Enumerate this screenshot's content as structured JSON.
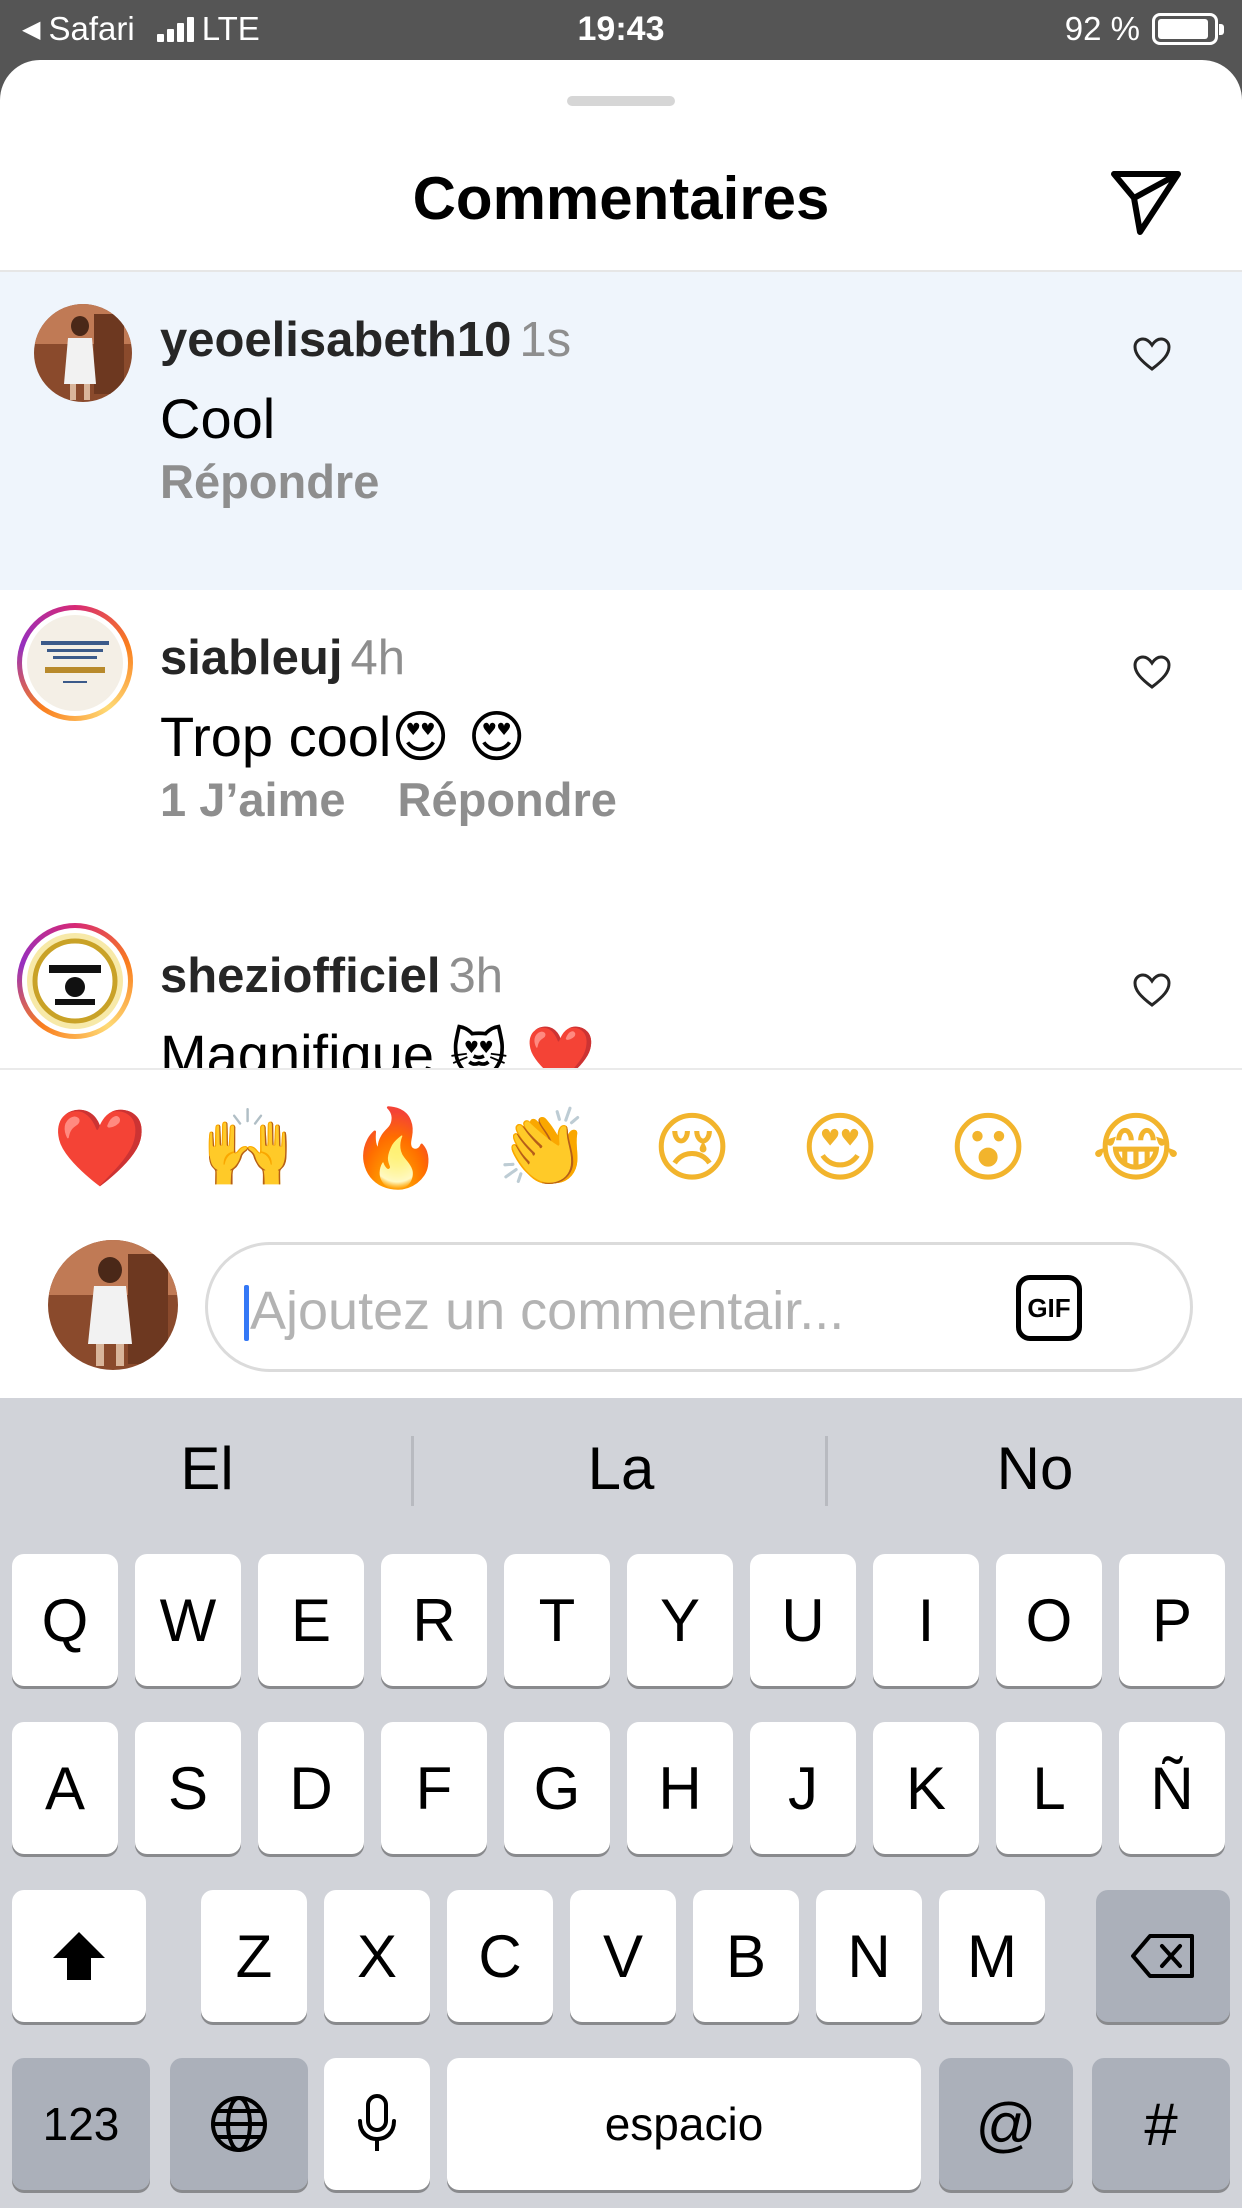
{
  "status_bar": {
    "back_glyph": "◀",
    "back_app": "Safari",
    "network": "LTE",
    "time": "19:43",
    "battery": "92 %",
    "battery_level": 0.92
  },
  "header": {
    "title": "Commentaires",
    "send_icon": "paper-plane-icon"
  },
  "comments": [
    {
      "username": "yeoelisabeth10",
      "time": "1s",
      "text": "Cool",
      "emojis": "",
      "actions": [
        "Répondre"
      ],
      "highlighted": true
    },
    {
      "username": "siableuj",
      "time": "4h",
      "text": "Trop cool",
      "emojis": "😍 😍",
      "actions": [
        "1 J’aime",
        "Répondre"
      ],
      "highlighted": false
    },
    {
      "username": "sheziofficiel",
      "time": "3h",
      "text": "Magnifique ",
      "emojis": "😻 ❤️",
      "actions": [],
      "highlighted": false
    }
  ],
  "reactions": [
    "❤️",
    "🙌",
    "🔥",
    "👏",
    "😢",
    "😍",
    "😮",
    "😂"
  ],
  "composer": {
    "placeholder": "Ajoutez un commentair...",
    "gif_label": "GIF"
  },
  "keyboard": {
    "suggestions": [
      "El",
      "La",
      "No"
    ],
    "row1": [
      "Q",
      "W",
      "E",
      "R",
      "T",
      "Y",
      "U",
      "I",
      "O",
      "P"
    ],
    "row2": [
      "A",
      "S",
      "D",
      "F",
      "G",
      "H",
      "J",
      "K",
      "L",
      "Ñ"
    ],
    "row3": [
      "Z",
      "X",
      "C",
      "V",
      "B",
      "N",
      "M"
    ],
    "numbers_label": "123",
    "space_label": "espacio",
    "at_label": "@",
    "hash_label": "#",
    "icons": {
      "shift": "shift-icon",
      "delete": "backspace-icon",
      "globe": "globe-icon",
      "mic": "microphone-icon"
    }
  },
  "colors": {
    "accent": "#3478f6",
    "highlight": "#eff5fc",
    "muted": "#8e8e8e",
    "keyboard_bg": "#d1d3d9"
  }
}
